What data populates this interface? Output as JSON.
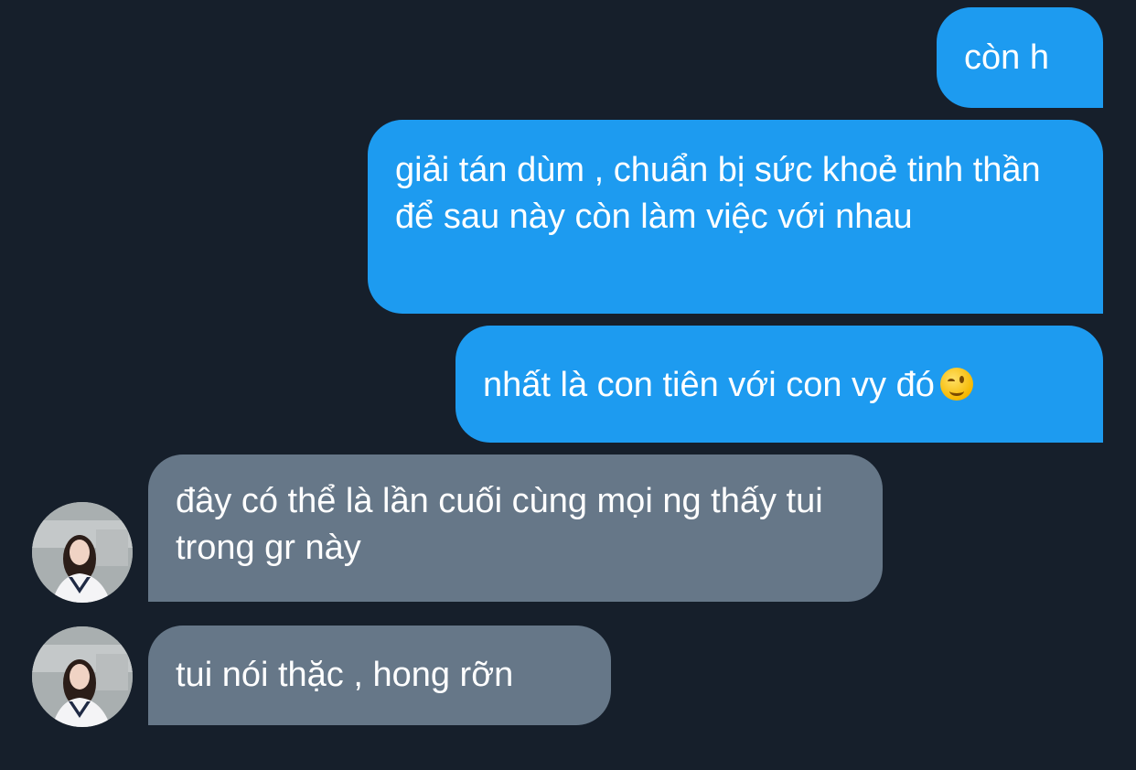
{
  "colors": {
    "background": "#161f2b",
    "outgoing_bubble": "#1d9bf0",
    "incoming_bubble": "#667788",
    "text": "#ffffff"
  },
  "messages": [
    {
      "direction": "outgoing",
      "text": "còn h"
    },
    {
      "direction": "outgoing",
      "text": "giải tán dùm , chuẩn bị sức khoẻ tinh thần để sau này còn làm việc với nhau"
    },
    {
      "direction": "outgoing",
      "text": "nhất là con tiên với con vy đó",
      "emoji": "winking-face-emoji"
    },
    {
      "direction": "incoming",
      "text": "đây có thể là lần cuối cùng mọi ng thấy tui trong gr này",
      "avatar": "contact-avatar"
    },
    {
      "direction": "incoming",
      "text": "tui nói thặc , hong rỡn",
      "avatar": "contact-avatar"
    }
  ]
}
